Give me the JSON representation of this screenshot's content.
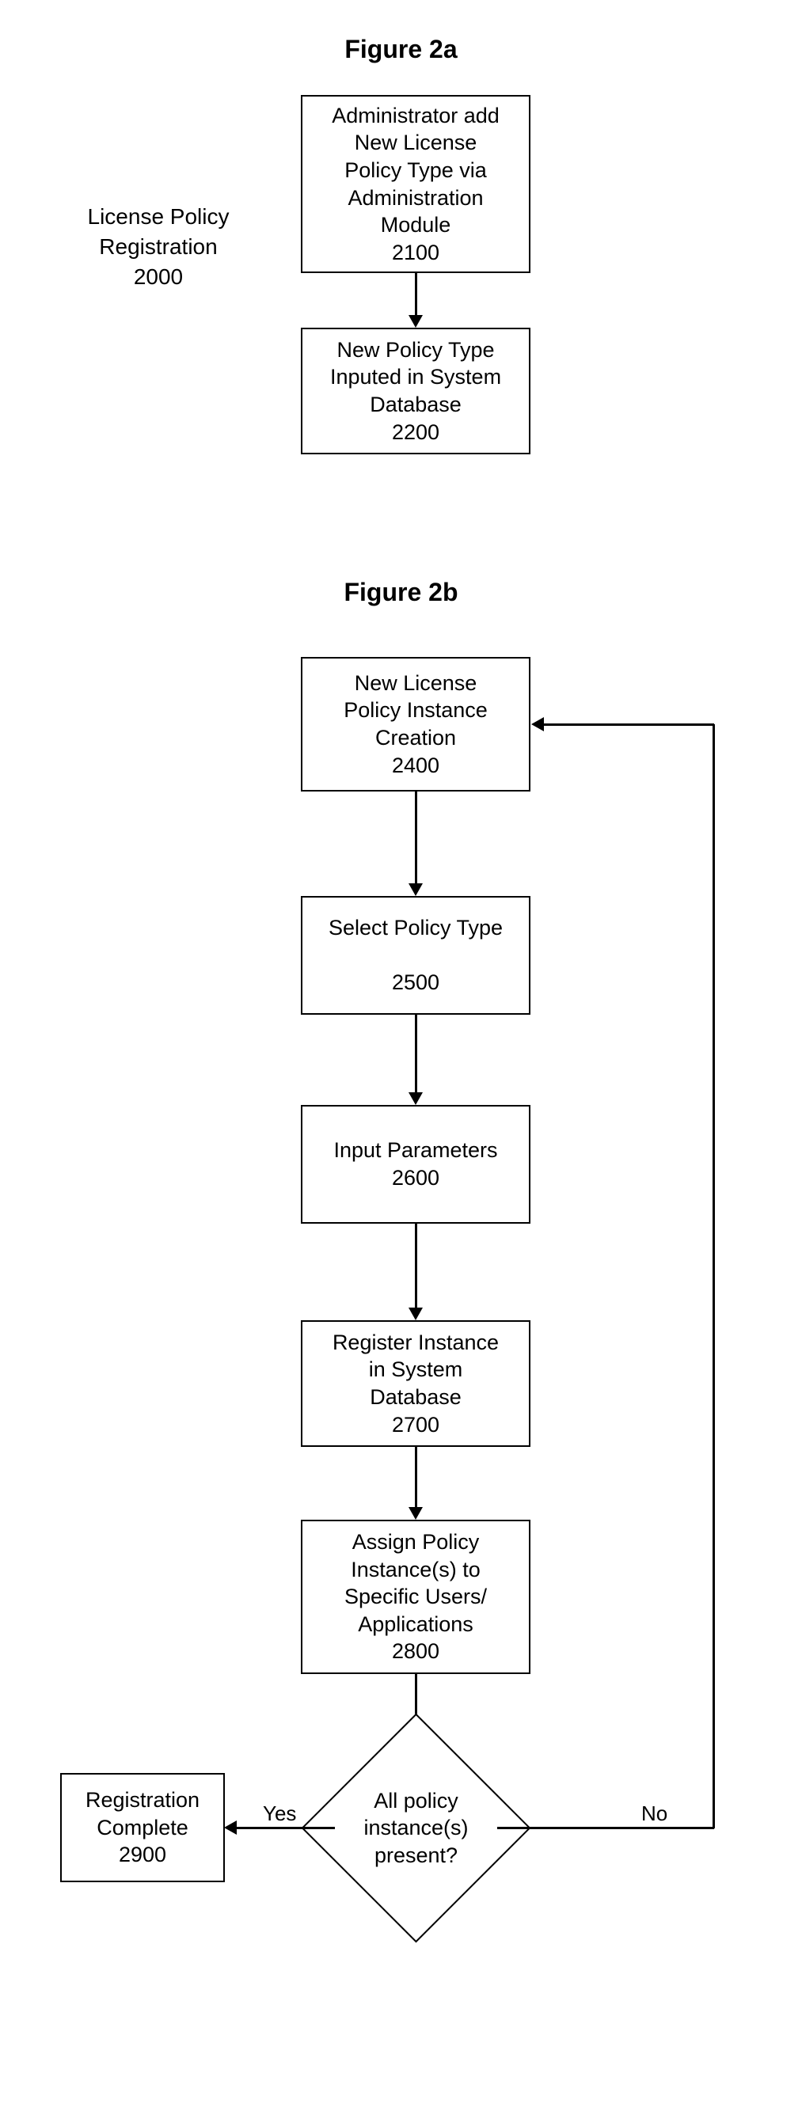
{
  "fig2a": {
    "title": "Figure 2a",
    "side_label": "License Policy\nRegistration\n2000",
    "box1": "Administrator add\nNew License\nPolicy Type  via\nAdministration\nModule\n2100",
    "box2": "New Policy Type\nInputed in System\nDatabase\n2200"
  },
  "fig2b": {
    "title": "Figure 2b",
    "box2400": "New License\nPolicy Instance\nCreation\n2400",
    "box2500": "Select Policy Type\n\n2500",
    "box2600": "Input Parameters\n2600",
    "box2700": "Register Instance\nin System\nDatabase\n2700",
    "box2800": "Assign Policy\nInstance(s)  to\nSpecific Users/\nApplications\n2800",
    "decision": "All policy\ninstance(s)\npresent?",
    "box2900": "Registration\nComplete\n2900",
    "yes": "Yes",
    "no": "No"
  }
}
